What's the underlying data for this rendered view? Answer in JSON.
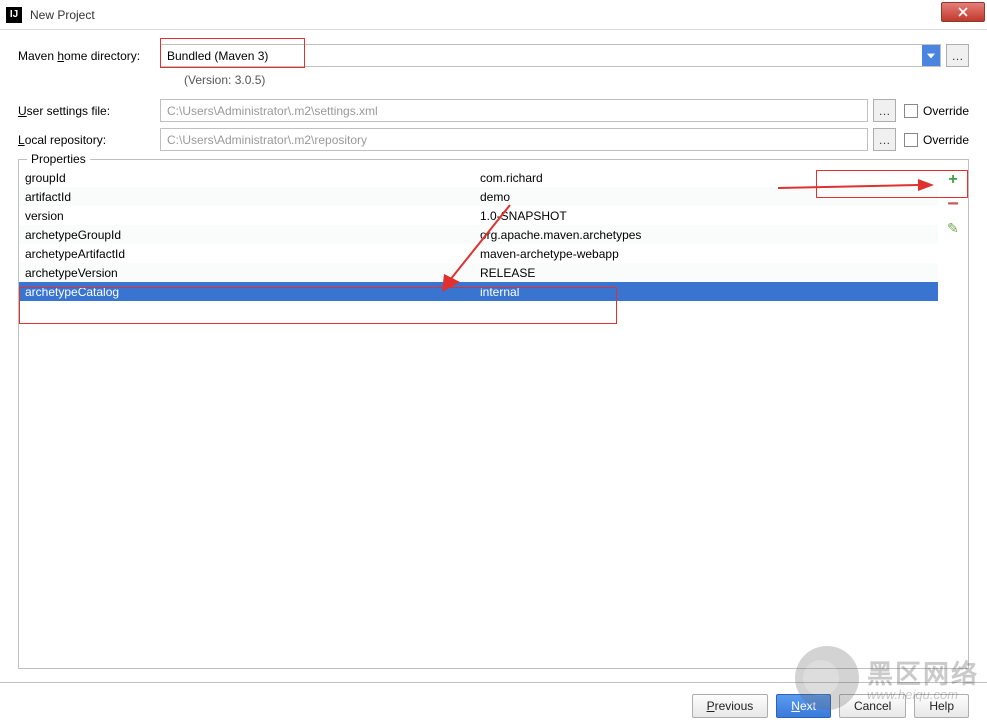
{
  "window": {
    "title": "New Project"
  },
  "maven": {
    "homeLabelPre": "Maven ",
    "homeLabelU": "h",
    "homeLabelPost": "ome directory:",
    "homeValue": "Bundled (Maven 3)",
    "version": "(Version: 3.0.5)"
  },
  "settings": {
    "userLabelPre": "",
    "userLabelU": "U",
    "userLabelPost": "ser settings file:",
    "userValue": "C:\\Users\\Administrator\\.m2\\settings.xml",
    "localLabelPre": "",
    "localLabelU": "L",
    "localLabelPost": "ocal repository:",
    "localValue": "C:\\Users\\Administrator\\.m2\\repository",
    "overrideLabel": "Override"
  },
  "properties": {
    "legend": "Properties",
    "rows": [
      {
        "k": "groupId",
        "v": "com.richard"
      },
      {
        "k": "artifactId",
        "v": "demo"
      },
      {
        "k": "version",
        "v": "1.0-SNAPSHOT"
      },
      {
        "k": "archetypeGroupId",
        "v": "org.apache.maven.archetypes"
      },
      {
        "k": "archetypeArtifactId",
        "v": "maven-archetype-webapp"
      },
      {
        "k": "archetypeVersion",
        "v": "RELEASE"
      },
      {
        "k": "archetypeCatalog",
        "v": "internal"
      }
    ]
  },
  "buttons": {
    "previousPre": "",
    "previousU": "P",
    "previousPost": "revious",
    "nextPre": "",
    "nextU": "N",
    "nextPost": "ext",
    "cancel": "Cancel",
    "help": "Help"
  },
  "watermark": {
    "line1": "黑区网络",
    "line2": "www.heiqu.com"
  }
}
